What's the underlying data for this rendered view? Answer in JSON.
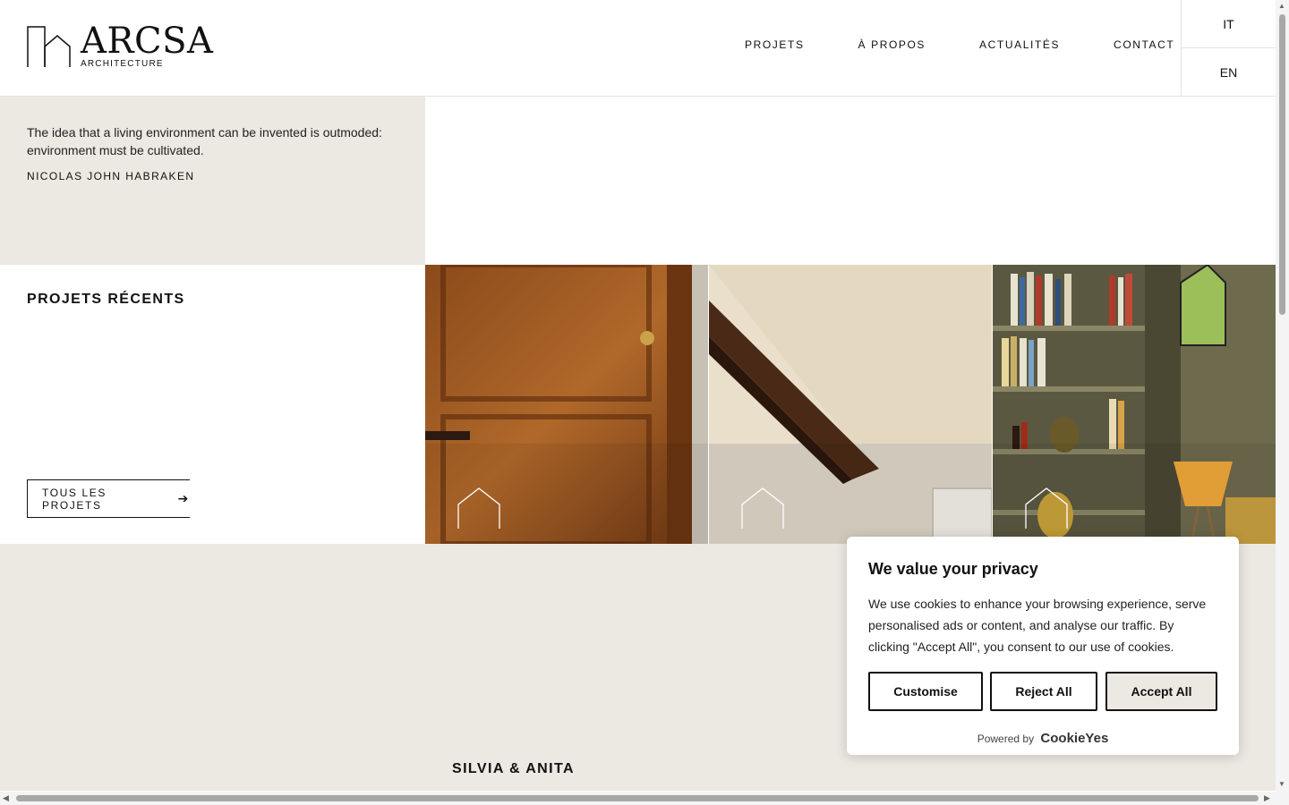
{
  "header": {
    "logo_name": "ARCSA",
    "logo_sub": "ARCHITECTURE",
    "nav": [
      "PROJETS",
      "À PROPOS",
      "ACTUALITÉS",
      "CONTACT"
    ],
    "languages": [
      "IT",
      "EN"
    ]
  },
  "quote": {
    "text": "The idea that a living environment can be invented is outmoded: environment must be cultivated.",
    "author": "NICOLAS JOHN HABRAKEN"
  },
  "recent": {
    "title": "PROJETS RÉCENTS",
    "all_button": "TOUS LES PROJETS"
  },
  "lower": {
    "name": "SILVIA & ANITA"
  },
  "cookie": {
    "title": "We value your privacy",
    "text": "We use cookies to enhance your browsing experience, serve personalised ads or content, and analyse our traffic. By clicking \"Accept All\", you consent to our use of cookies.",
    "customise": "Customise",
    "reject": "Reject All",
    "accept": "Accept All",
    "powered_by": "Powered by",
    "brand": "CookieYes"
  },
  "colors": {
    "beige": "#ece8e2",
    "text": "#111111"
  }
}
